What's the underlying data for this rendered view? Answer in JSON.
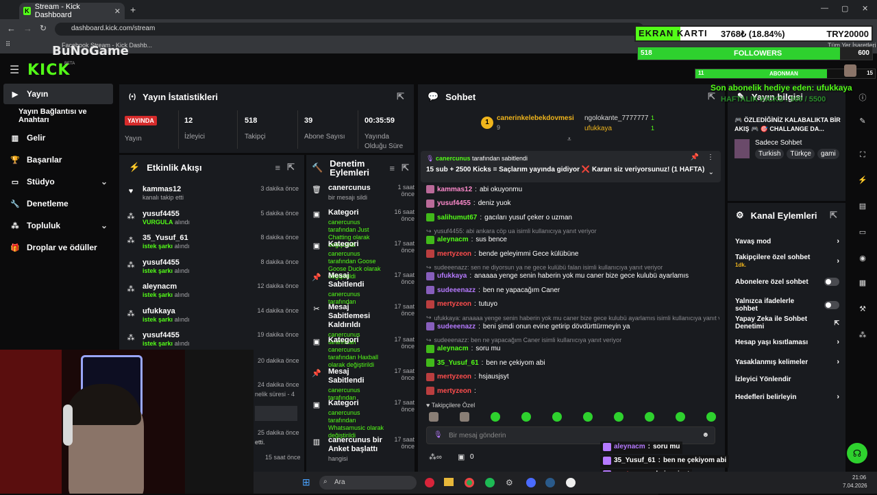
{
  "browser": {
    "tab_title": "Stream - Kick Dashboard",
    "url": "dashboard.kick.com/stream",
    "bookmarks": [
      "Facebook",
      "Stream - Kick Dashb..."
    ],
    "bookmarks_right": "Tüm Yer İşaretleri",
    "watermark": "BuNoGame"
  },
  "header": {
    "logo": "KICK",
    "beta": "BETA"
  },
  "sidebar": {
    "items": [
      {
        "label": "Yayın",
        "icon": "video-icon"
      },
      {
        "label": "Yayın Bağlantısı ve Anahtarı",
        "icon": ""
      },
      {
        "label": "Gelir",
        "icon": "chart-icon"
      },
      {
        "label": "Başarılar",
        "icon": "trophy-icon"
      },
      {
        "label": "Stüdyo",
        "icon": "studio-icon"
      },
      {
        "label": "Denetleme",
        "icon": "wrench-icon"
      },
      {
        "label": "Topluluk",
        "icon": "people-icon"
      },
      {
        "label": "Droplar ve ödüller",
        "icon": "gift-icon"
      }
    ]
  },
  "stats": {
    "title": "Yayın İstatistikleri",
    "live_badge": "YAYINDA",
    "status_label": "Yayın",
    "viewers": "12",
    "viewers_label": "İzleyici",
    "followers": "518",
    "followers_label": "Takipçi",
    "subs": "39",
    "subs_label": "Abone Sayısı",
    "uptime": "00:35:59",
    "uptime_label": "Yayında Olduğu Süre"
  },
  "activity": {
    "title": "Etkinlik Akışı",
    "events": [
      {
        "user": "kammas12",
        "desc": "kanalı takip etti",
        "ago": "3 dakika önce",
        "green": false
      },
      {
        "user": "yusuf4455",
        "desc": "VURGULA",
        "suffix": "alındı",
        "ago": "5 dakika önce",
        "green": true
      },
      {
        "user": "35_Yusuf_61",
        "desc": "istek şarkı",
        "suffix": "alındı",
        "ago": "8 dakika önce",
        "green": true
      },
      {
        "user": "yusuf4455",
        "desc": "istek şarkı",
        "suffix": "alındı",
        "ago": "8 dakika önce",
        "green": true
      },
      {
        "user": "aleynacm",
        "desc": "istek şarkı",
        "suffix": "alındı",
        "ago": "12 dakika önce",
        "green": true
      },
      {
        "user": "ufukkaya",
        "desc": "istek şarkı",
        "suffix": "alındı",
        "ago": "14 dakika önce",
        "green": true
      },
      {
        "user": "yusuf4455",
        "desc": "istek şarkı",
        "suffix": "alındı",
        "ago": "19 dakika önce",
        "green": true
      }
    ],
    "partial": [
      {
        "ago": "20 dakika önce"
      },
      {
        "ago": "24 dakika önce",
        "text": "nelik süresi - 4"
      },
      {
        "ago": "25 dakika önce",
        "text": "etti."
      },
      {
        "ago": "15 saat önce"
      }
    ]
  },
  "moderation": {
    "title": "Denetim Eylemleri",
    "actions": [
      {
        "title": "canercunus",
        "desc": "bir mesajı sildi",
        "ago": "1 saat önce",
        "icon": "trash-icon"
      },
      {
        "title": "Kategori",
        "desc": "canercunus tarafından Just Chatting olarak değiştirildi",
        "ago": "16 saat önce",
        "icon": "category-icon"
      },
      {
        "title": "Kategori",
        "desc": "canercunus tarafından Goose Goose Duck olarak değiştirildi",
        "ago": "17 saat önce",
        "icon": "category-icon"
      },
      {
        "title": "Mesaj Sabitlendi",
        "desc": "canercunus tarafından",
        "ago": "17 saat önce",
        "icon": "pin-icon"
      },
      {
        "title": "Mesaj Sabitlemesi Kaldırıldı",
        "desc": "canercunus tarafından",
        "ago": "17 saat önce",
        "icon": "unpin-icon"
      },
      {
        "title": "Kategori",
        "desc": "canercunus tarafından Haxball olarak değiştirildi",
        "ago": "17 saat önce",
        "icon": "category-icon"
      },
      {
        "title": "Mesaj Sabitlendi",
        "desc": "canercunus tarafından",
        "ago": "17 saat önce",
        "icon": "pin-icon"
      },
      {
        "title": "Kategori",
        "desc": "canercunus tarafından Whatsamusic olarak değiştirildi",
        "ago": "17 saat önce",
        "icon": "category-icon"
      },
      {
        "title": "canercunus bir Anket başlattı",
        "desc": "hangisi",
        "ago": "17 saat önce",
        "icon": "poll-icon"
      }
    ]
  },
  "chat": {
    "title": "Sohbet",
    "leaders": [
      {
        "name": "canerinkelebekdovmesi",
        "count": "9"
      },
      {
        "name": "ngolokante_7777777",
        "count": "1"
      },
      {
        "name": "ufukkaya",
        "count": "1"
      }
    ],
    "pinned_by": "canercunus",
    "pinned_by_suffix": "tarafından sabitlendi",
    "pinned_text": "15 sub + 2500 Kicks = Saçlarım yayında gidiyor ❌ Kararı siz veriyorsunuz! (1 HAFTA)",
    "messages": [
      {
        "reply": "",
        "user": "kammas12",
        "text": "abi okuyonmu",
        "color": "#ff8bcd"
      },
      {
        "reply": "",
        "user": "yusuf4455",
        "text": "deniz yuok",
        "color": "#ff8bcd"
      },
      {
        "reply": "",
        "user": "salihumut67",
        "text": "gacıları yusuf çeker o uzman",
        "color": "#53fc18"
      },
      {
        "reply": "yusuf4455: abi ankara cöp ua isimli kullanıcıya yanıt veriyor",
        "user": "aleynacm",
        "text": "sus bence",
        "color": "#53fc18"
      },
      {
        "reply": "",
        "user": "mertyzeon",
        "text": "bende geleyimmi Gece külübüne",
        "color": "#ff4d4d"
      },
      {
        "reply": "sudeeenazz: sen ne diyorsun ya ne gece kulübü falan isimli kullanıcıya yanıt veriyor",
        "user": "ufukkaya",
        "text": "anaaaa yenge senin haberin yok mu caner bize gece kulubü ayarlamıs",
        "color": "#b67aff"
      },
      {
        "reply": "",
        "user": "sudeeenazz",
        "text": "ben ne yapacağım Caner",
        "color": "#b67aff"
      },
      {
        "reply": "",
        "user": "mertyzeon",
        "text": "tutuyo",
        "color": "#ff4d4d"
      },
      {
        "reply": "ufukkaya: anaaaa yenge senin haberin yok mu caner bize gece kulubü ayarlamıs isimli kullanıcıya yanıt ve...",
        "user": "sudeeenazz",
        "text": "beni şimdi onun evine getirip dövdürttürmeyin ya",
        "color": "#b67aff"
      },
      {
        "reply": "sudeeenazz: ben ne yapacağım Caner isimli kullanıcıya yanıt veriyor",
        "user": "aleynacm",
        "text": "soru mu",
        "color": "#53fc18"
      },
      {
        "reply": "",
        "user": "35_Yusuf_61",
        "text": "ben ne çekiyom abi",
        "color": "#53fc18"
      },
      {
        "reply": "",
        "user": "mertyzeon",
        "text": "hsjausjsyt",
        "color": "#ff4d4d"
      },
      {
        "reply": "",
        "user": "mertyzeon",
        "text": "",
        "color": "#ff4d4d"
      }
    ],
    "followers_only": "Takipçilere Özel",
    "input_placeholder": "Bir mesaj gönderin",
    "footer_count": "0"
  },
  "stream_info": {
    "title": "Yayın bilgisi",
    "stream_title": "🎮 ÖZLEDİĞİNİZ KALABALIKTA BİR AKIŞ 🎮 🎯 CHALLANGE DA...",
    "category": "Sadece Sohbet",
    "tags": [
      "Turkish",
      "Türkçe",
      "gami"
    ]
  },
  "channel_actions": {
    "title": "Kanal Eylemleri",
    "items": [
      {
        "label": "Yavaş mod",
        "type": "chevron",
        "sub": ""
      },
      {
        "label": "Takipçilere özel sohbet",
        "type": "chevron",
        "sub": "1dk."
      },
      {
        "label": "Abonelere özel sohbet",
        "type": "toggle",
        "sub": ""
      },
      {
        "label": "Yalnızca ifadelerle sohbet",
        "type": "toggle",
        "sub": ""
      },
      {
        "label": "Yapay Zeka ile Sohbet Denetimi",
        "type": "external",
        "sub": ""
      },
      {
        "label": "Hesap yaşı kısıtlaması",
        "type": "chevron",
        "sub": ""
      },
      {
        "label": "Yasaklanmış kelimeler",
        "type": "chevron",
        "sub": ""
      },
      {
        "label": "İzleyici Yönlendir",
        "type": "none",
        "sub": ""
      },
      {
        "label": "Hedefleri belirleyin",
        "type": "chevron",
        "sub": ""
      }
    ]
  },
  "overlays": {
    "gpu_label": "EKRAN KARTI",
    "gpu_value": "3768₺ (18.84%)",
    "gpu_target": "TRY20000",
    "gpu_progress": 0.1884,
    "followers_current": "518",
    "followers_label": "FOLLOWERS",
    "followers_goal": "600",
    "followers_progress": 0.863,
    "subs_current": "11",
    "subs_label": "ABONMAN",
    "subs_goal": "15",
    "subs_progress": 0.733,
    "gift_text": "Son abonelik hediye eden: ufukkaya",
    "weekly_text": "HAFTALIK KICKS : 500 / 5500",
    "chat_overlay": [
      {
        "user": "aleynacm",
        "text": "soru mu",
        "color": "#b67aff"
      },
      {
        "user": "35_Yusuf_61",
        "text": "ben ne çekiyom abi",
        "color": "#ffffff"
      },
      {
        "user": "mertyzeon",
        "text": "hsjausjsyt",
        "color": "#ff4d4d"
      },
      {
        "user": "mertyzeon",
        "text": "",
        "color": "#ff4d4d"
      }
    ]
  },
  "taskbar": {
    "search": "Ara",
    "time": "21:06",
    "date": "7.04.2026"
  }
}
